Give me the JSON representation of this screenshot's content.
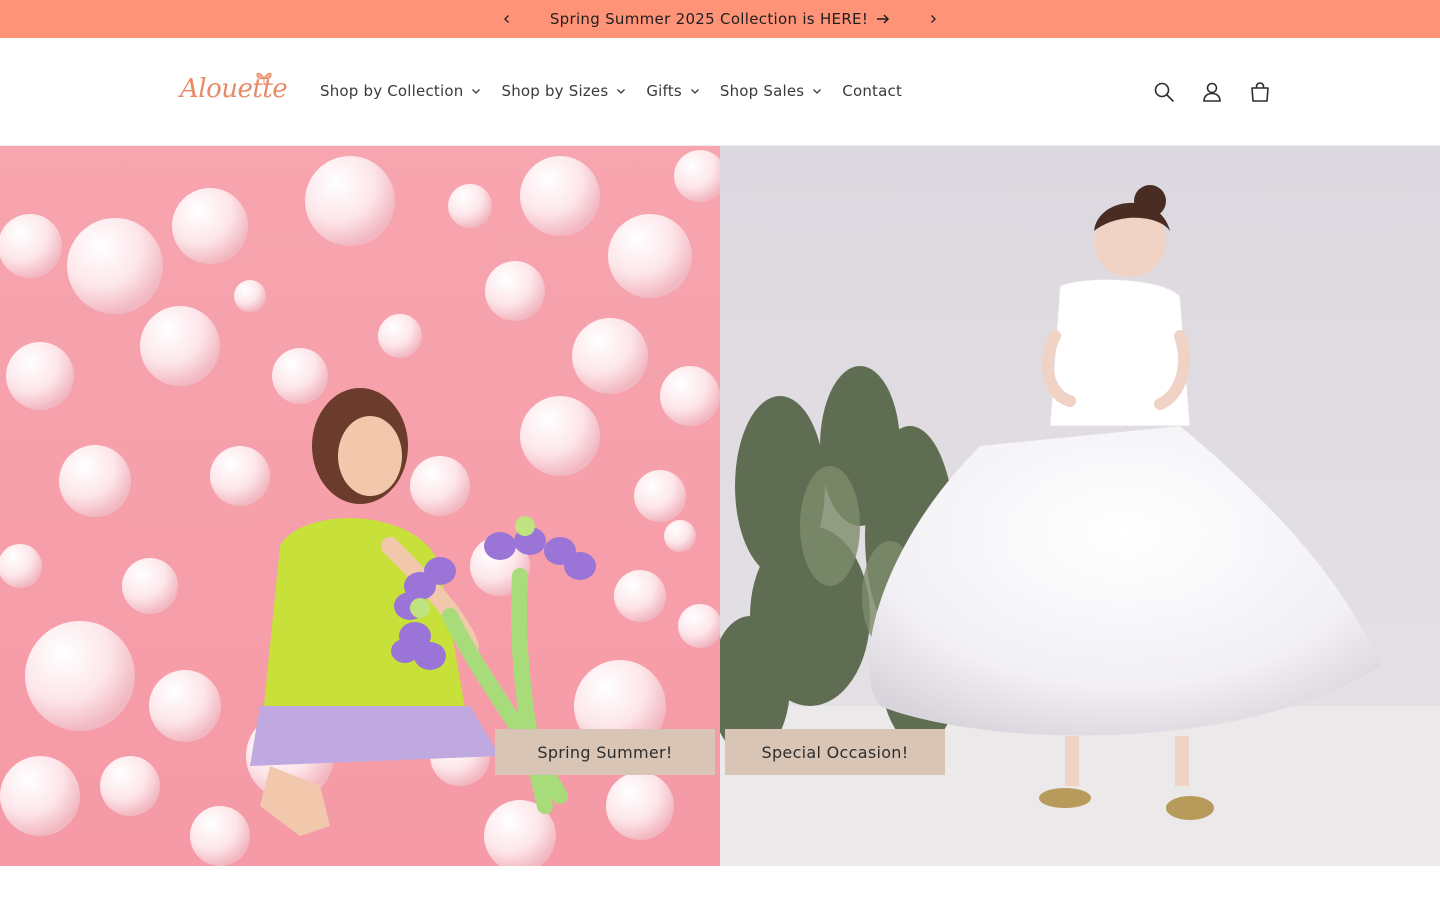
{
  "announcement": {
    "message": "Spring Summer 2025 Collection is HERE!",
    "background": "#ff9377"
  },
  "brand": {
    "logo_text": "Alouette",
    "logo_color": "#e98a67"
  },
  "nav": {
    "items": [
      {
        "label": "Shop by Collection",
        "has_dropdown": true
      },
      {
        "label": "Shop by Sizes",
        "has_dropdown": true
      },
      {
        "label": "Gifts",
        "has_dropdown": true
      },
      {
        "label": "Shop Sales",
        "has_dropdown": true
      },
      {
        "label": "Contact",
        "has_dropdown": false
      }
    ]
  },
  "header_icons": [
    "search-icon",
    "account-icon",
    "cart-icon"
  ],
  "hero": {
    "left": {
      "button_label": "Spring Summer!",
      "bg_color": "#f7a5af"
    },
    "right": {
      "button_label": "Special Occasion!",
      "bg_color": "#ddd9df"
    },
    "button_color": "#d9c5b6"
  }
}
